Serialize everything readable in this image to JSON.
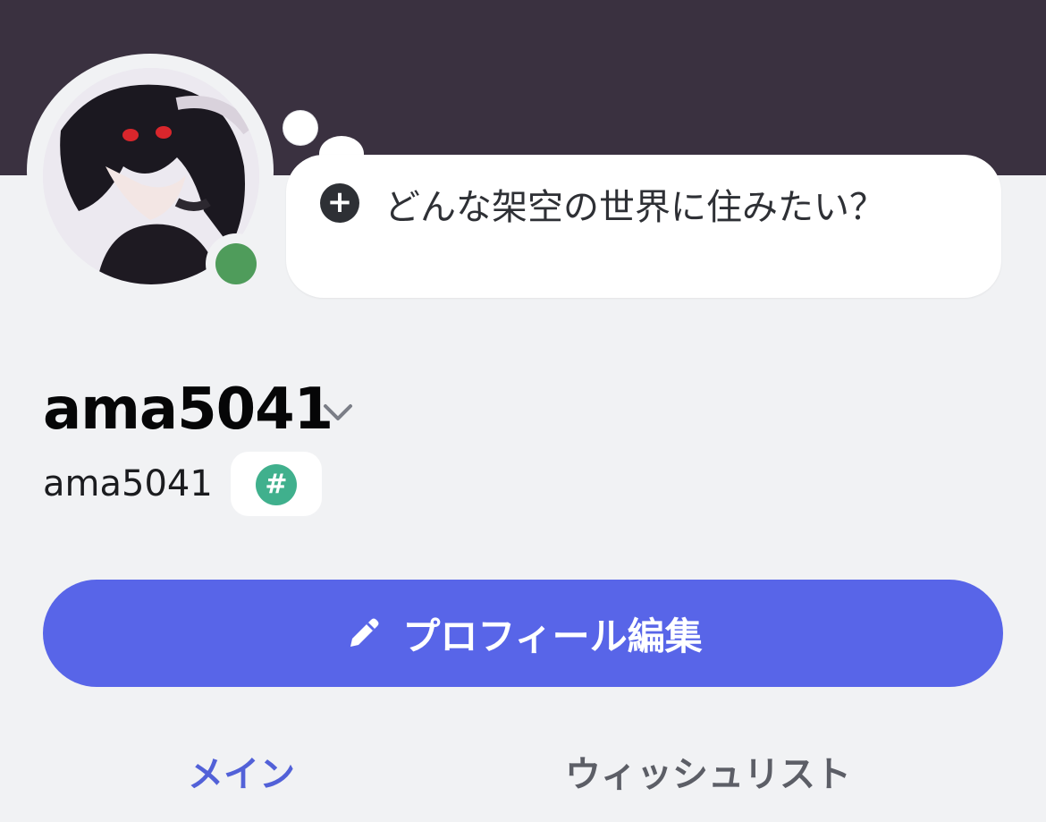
{
  "profile": {
    "display_name": "ama5041",
    "username": "ama5041",
    "status_color": "#4f9c5b",
    "badge_icon": "hashtag-badge-icon"
  },
  "status_bubble": {
    "plus_icon": "+",
    "prompt": "どんな架空の世界に住みたい？"
  },
  "actions": {
    "edit_profile_label": "プロフィール編集"
  },
  "tabs": [
    {
      "label": "メイン",
      "active": true
    },
    {
      "label": "ウィッシュリスト",
      "active": false
    }
  ],
  "colors": {
    "banner": "#3a3140",
    "accent": "#5865e8",
    "active_tab": "#5261d8"
  }
}
